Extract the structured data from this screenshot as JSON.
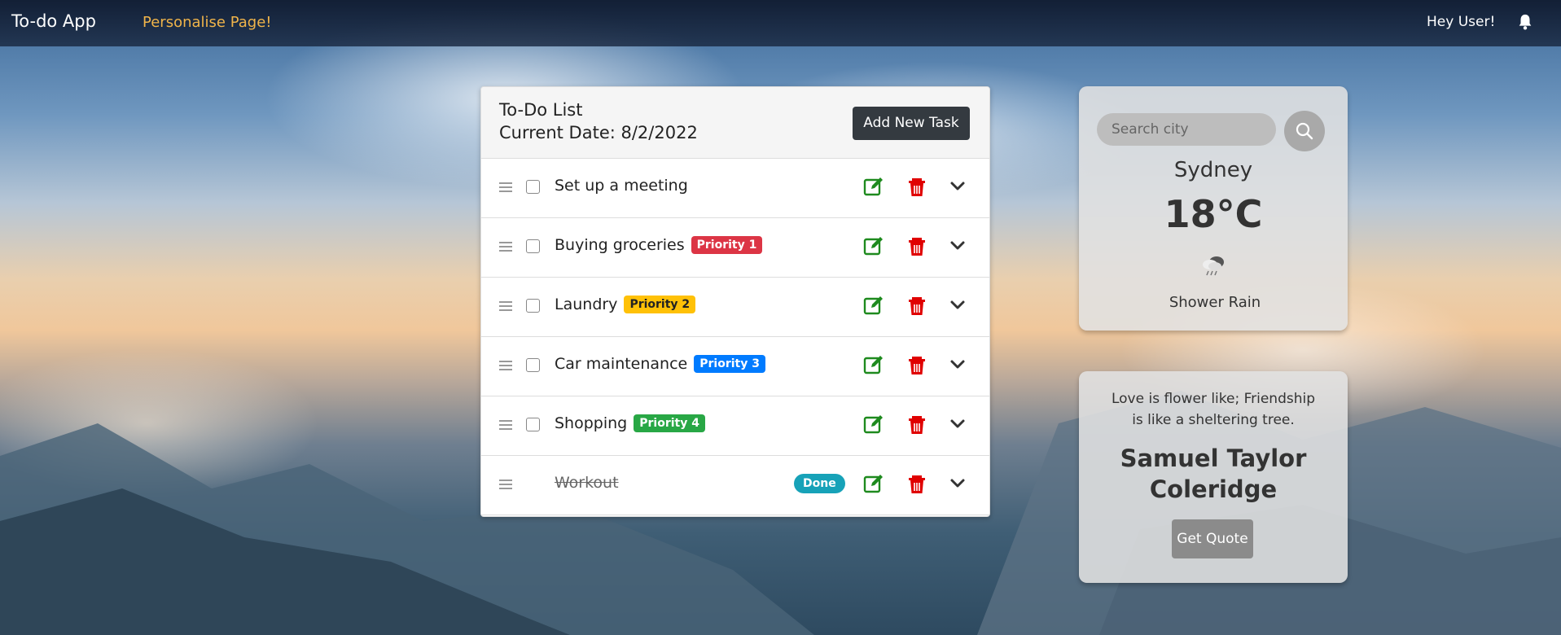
{
  "navbar": {
    "brand": "To-do App",
    "personalise_link": "Personalise Page!",
    "greeting": "Hey User!",
    "bell_icon": "bell-icon"
  },
  "todo": {
    "title": "To-Do List",
    "date": "Current Date: 8/2/2022",
    "add_button": "Add New Task",
    "tasks": [
      {
        "text": "Set up a meeting",
        "badge": "",
        "done": false
      },
      {
        "text": "Buying groceries",
        "badge": "Priority 1",
        "badge_color": "#dc3545",
        "done": false
      },
      {
        "text": "Laundry",
        "badge": "Priority 2",
        "badge_color": "#ffc107",
        "done": false
      },
      {
        "text": "Car maintenance",
        "badge": "Priority 3",
        "badge_color": "#007bff",
        "done": false
      },
      {
        "text": "Shopping",
        "badge": "Priority 4",
        "badge_color": "#28a745",
        "done": false
      },
      {
        "text": "Workout",
        "badge": "",
        "done": true,
        "status": "Done"
      }
    ],
    "icons": {
      "drag": "drag-handle-icon",
      "edit": "edit-icon",
      "delete": "trash-icon",
      "expand": "chevron-down-icon"
    }
  },
  "weather": {
    "search_placeholder": "Search city",
    "city": "Sydney",
    "temperature": "18°C",
    "condition": "Shower Rain",
    "icon": "shower-rain-icon"
  },
  "quote": {
    "text_line1": "Love is flower like; Friendship",
    "text_line2": "is like a sheltering tree.",
    "author_line1": "Samuel Taylor",
    "author_line2": "Coleridge",
    "button": "Get Quote"
  },
  "colors": {
    "navbar_link": "#f0b44a",
    "edit_icon": "#1e8a1e",
    "delete_icon": "#e00000",
    "done_badge": "#17a2b8"
  }
}
